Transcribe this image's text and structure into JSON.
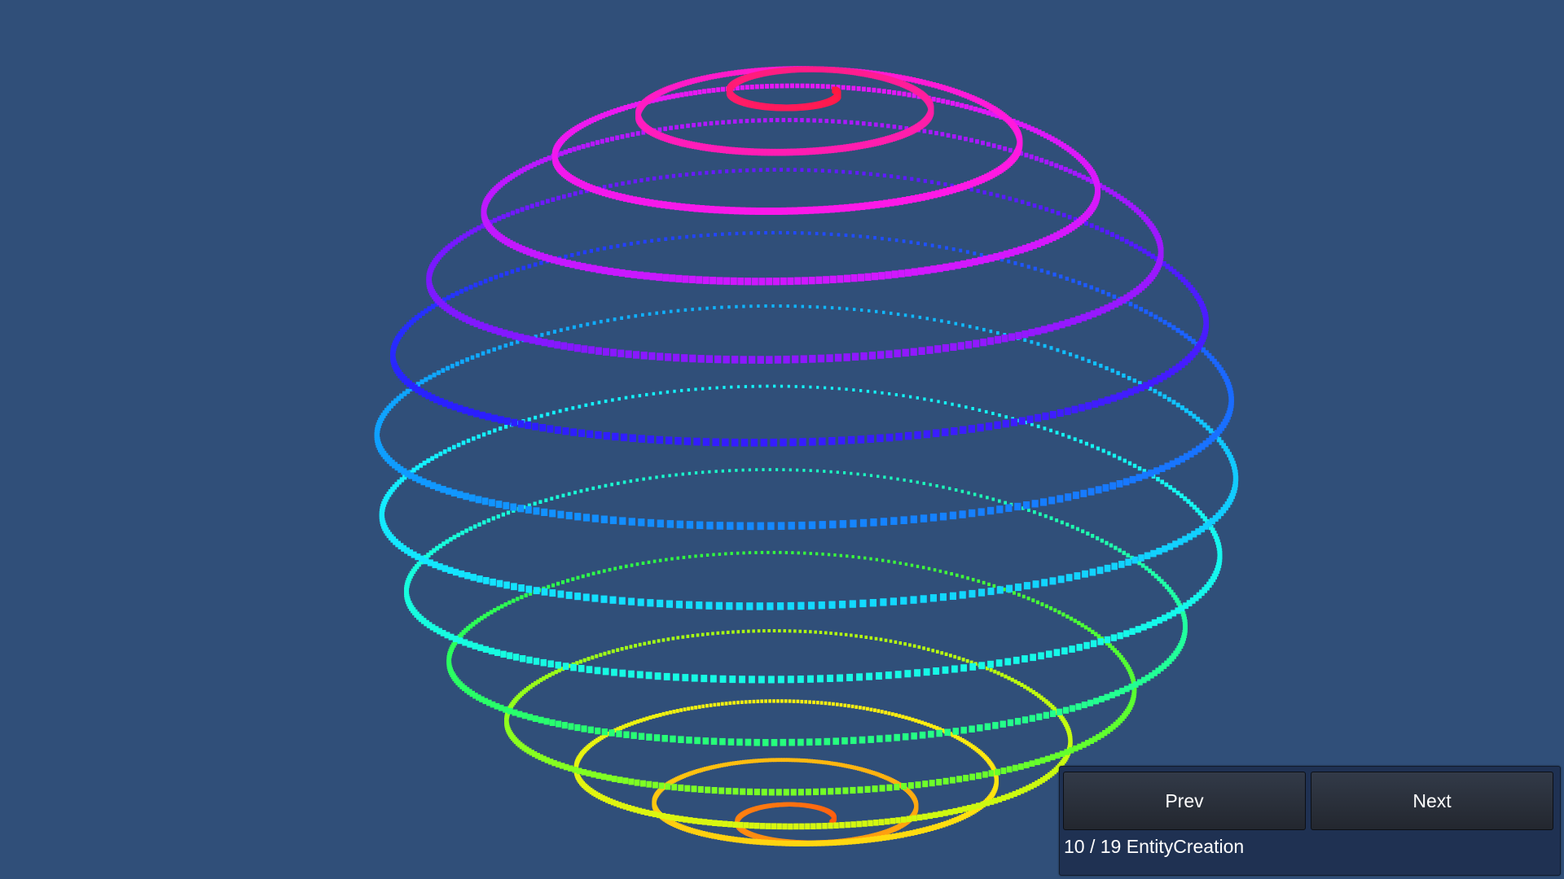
{
  "viewport": {
    "background": "#304f79",
    "object": "helix-sphere-of-points"
  },
  "helix_colors": [
    "#ff1a3c",
    "#ff1ea8",
    "#ff19e6",
    "#d018ff",
    "#8a18ff",
    "#2a1eff",
    "#0fa0ff",
    "#14f0ff",
    "#18ffd8",
    "#30ff40",
    "#b4ff10",
    "#ffee10",
    "#ffae10",
    "#ff5a10"
  ],
  "nav": {
    "prev_label": "Prev",
    "next_label": "Next",
    "scene_label": "10 / 19 EntityCreation"
  }
}
